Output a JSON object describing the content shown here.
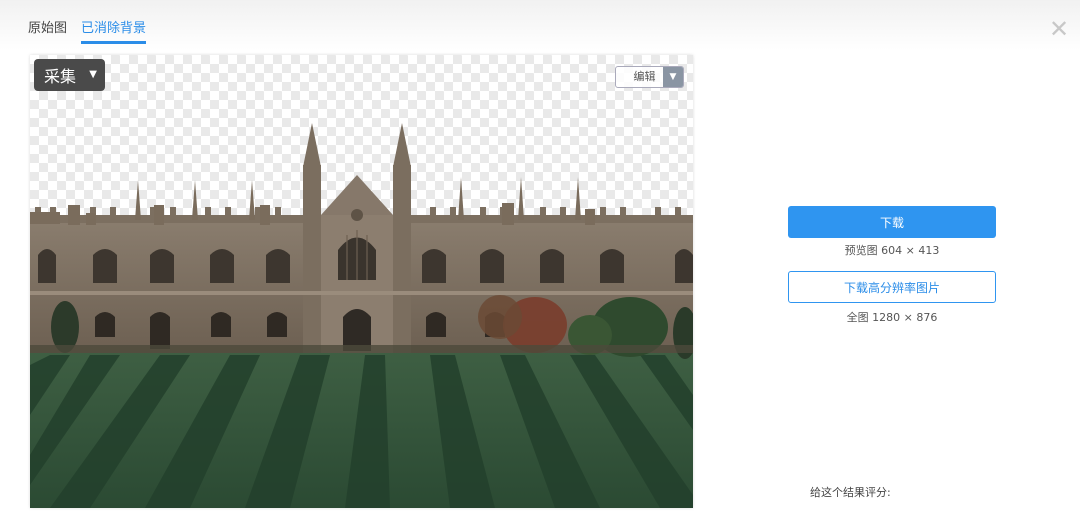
{
  "tabs": [
    {
      "label": "原始图",
      "active": false
    },
    {
      "label": "已消除背景",
      "active": true
    }
  ],
  "close_icon": "close-x-icon",
  "canvas": {
    "collect_label": "采集",
    "edit_label": "编辑",
    "image_description": ""
  },
  "download": {
    "button_label": "下载",
    "preview_info": "预览图 604 × 413",
    "hd_button_label": "下载高分辨率图片",
    "full_info": "全图 1280 × 876"
  },
  "rating_label": "给这个结果评分:",
  "colors": {
    "accent": "#2f95f0",
    "dark_button": "#4a4a4a"
  }
}
